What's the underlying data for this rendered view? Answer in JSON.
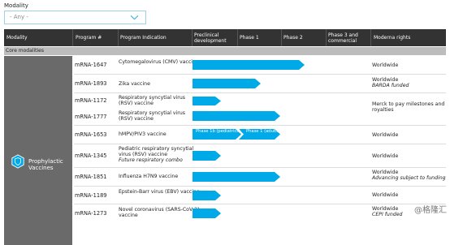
{
  "filter": {
    "label": "Modality",
    "value": "- Any -"
  },
  "headers": {
    "modality": "Modality",
    "program": "Program #",
    "indication": "Program Indication",
    "preclinical": "Preclinical development",
    "phase1": "Phase 1",
    "phase2": "Phase 2",
    "phase3": "Phase 3 and commercial",
    "rights": "Moderna rights"
  },
  "section": "Core modalities",
  "group": {
    "label": "Prophylactic Vaccines",
    "icon": "shield-vaccine-icon"
  },
  "rows": [
    {
      "program": "mRNA-1647",
      "indication": "Cytomegalovirus (CMV) vaccine",
      "indication_sub": "",
      "stage": "Phase 2",
      "rights": "Worldwide",
      "rights_sub": ""
    },
    {
      "program": "mRNA-1893",
      "indication": "Zika vaccine",
      "indication_sub": "",
      "stage": "Phase 1",
      "rights": "Worldwide",
      "rights_sub": "BARDA funded"
    },
    {
      "program": "mRNA-1172",
      "indication": "Respiratory syncytial virus (RSV) vaccine",
      "indication_sub": "",
      "stage": "Preclinical development",
      "rights": "Merck to pay milestones and royalties",
      "rights_sub": ""
    },
    {
      "program": "mRNA-1777",
      "indication": "Respiratory syncytial virus (RSV) vaccine",
      "indication_sub": "",
      "stage": "Phase 1",
      "rights": "",
      "rights_sub": ""
    },
    {
      "program": "mRNA-1653",
      "indication": "hMPV/PIV3 vaccine",
      "indication_sub": "",
      "stage": "Phase 1",
      "phase_labels": [
        "Phase 1b (pediatrics)",
        "Phase 1 (adults)"
      ],
      "rights": "Worldwide",
      "rights_sub": ""
    },
    {
      "program": "mRNA-1345",
      "indication": "Pediatric respiratory syncytial virus (RSV) vaccine",
      "indication_sub": "Future respiratory combo",
      "stage": "Preclinical development",
      "rights": "Worldwide",
      "rights_sub": ""
    },
    {
      "program": "mRNA-1851",
      "indication": "Influenza H7N9 vaccine",
      "indication_sub": "",
      "stage": "Phase 1",
      "rights": "Worldwide",
      "rights_sub": "Advancing subject to funding"
    },
    {
      "program": "mRNA-1189",
      "indication": "Epstein-Barr virus (EBV) vaccine",
      "indication_sub": "",
      "stage": "Preclinical development",
      "rights": "Worldwide",
      "rights_sub": ""
    },
    {
      "program": "mRNA-1273",
      "indication": "Novel coronavirus (SARS-CoV-2) vaccine",
      "indication_sub": "",
      "stage": "Preclinical development",
      "rights": "Worldwide",
      "rights_sub": "CEPI funded"
    }
  ],
  "watermark": "@格隆汇",
  "colors": {
    "bar": "#00a9e8",
    "header": "#333333",
    "section": "#bdbdbd",
    "group": "#6a6a6a",
    "select_border": "#9ed1e8"
  }
}
